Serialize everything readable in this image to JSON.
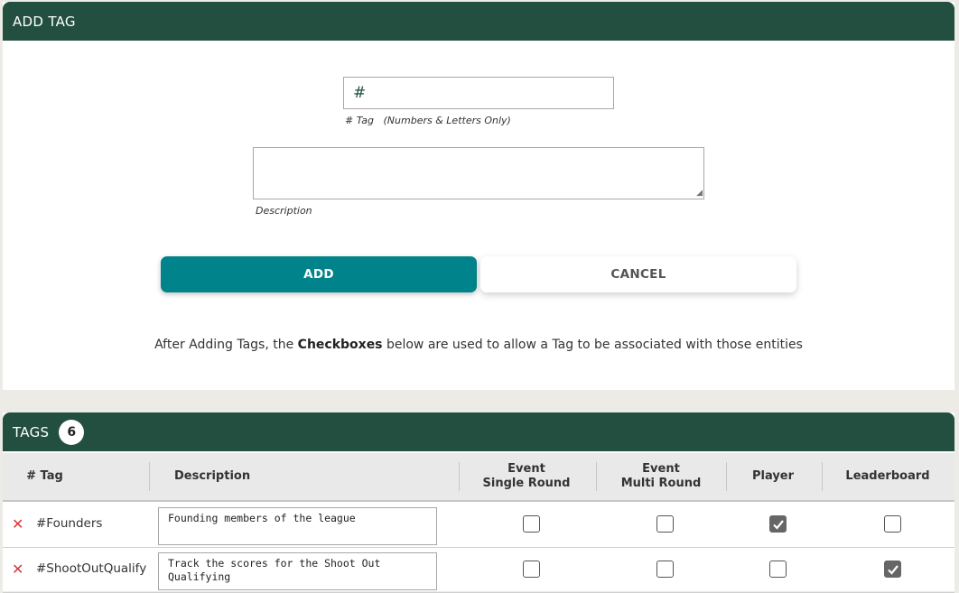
{
  "add_panel": {
    "title": "ADD TAG",
    "tag_input_prefix": "#",
    "tag_hint_label": "# Tag",
    "tag_hint_note": "(Numbers & Letters Only)",
    "description_label": "Description",
    "add_label": "ADD",
    "cancel_label": "CANCEL",
    "info_before": "After Adding Tags, the ",
    "info_bold": "Checkboxes",
    "info_after": " below are used to allow a Tag to be associated with those entities"
  },
  "tags_panel": {
    "title": "TAGS",
    "count": "6",
    "columns": {
      "tag": "# Tag",
      "description": "Description",
      "event_single_line1": "Event",
      "event_single_line2": "Single Round",
      "event_multi_line1": "Event",
      "event_multi_line2": "Multi Round",
      "player": "Player",
      "leaderboard": "Leaderboard"
    },
    "rows": [
      {
        "delete_icon": "✕",
        "tag": "#Founders",
        "description": "Founding members of the league",
        "event_single": false,
        "event_multi": false,
        "player": true,
        "leaderboard": false
      },
      {
        "delete_icon": "✕",
        "tag": "#ShootOutQualify",
        "description": "Track the scores for the Shoot Out Qualifying",
        "event_single": false,
        "event_multi": false,
        "player": false,
        "leaderboard": true
      }
    ]
  },
  "colors": {
    "header_green": "#224f3f",
    "add_teal": "#00838a",
    "delete_red": "#d43a3a"
  }
}
